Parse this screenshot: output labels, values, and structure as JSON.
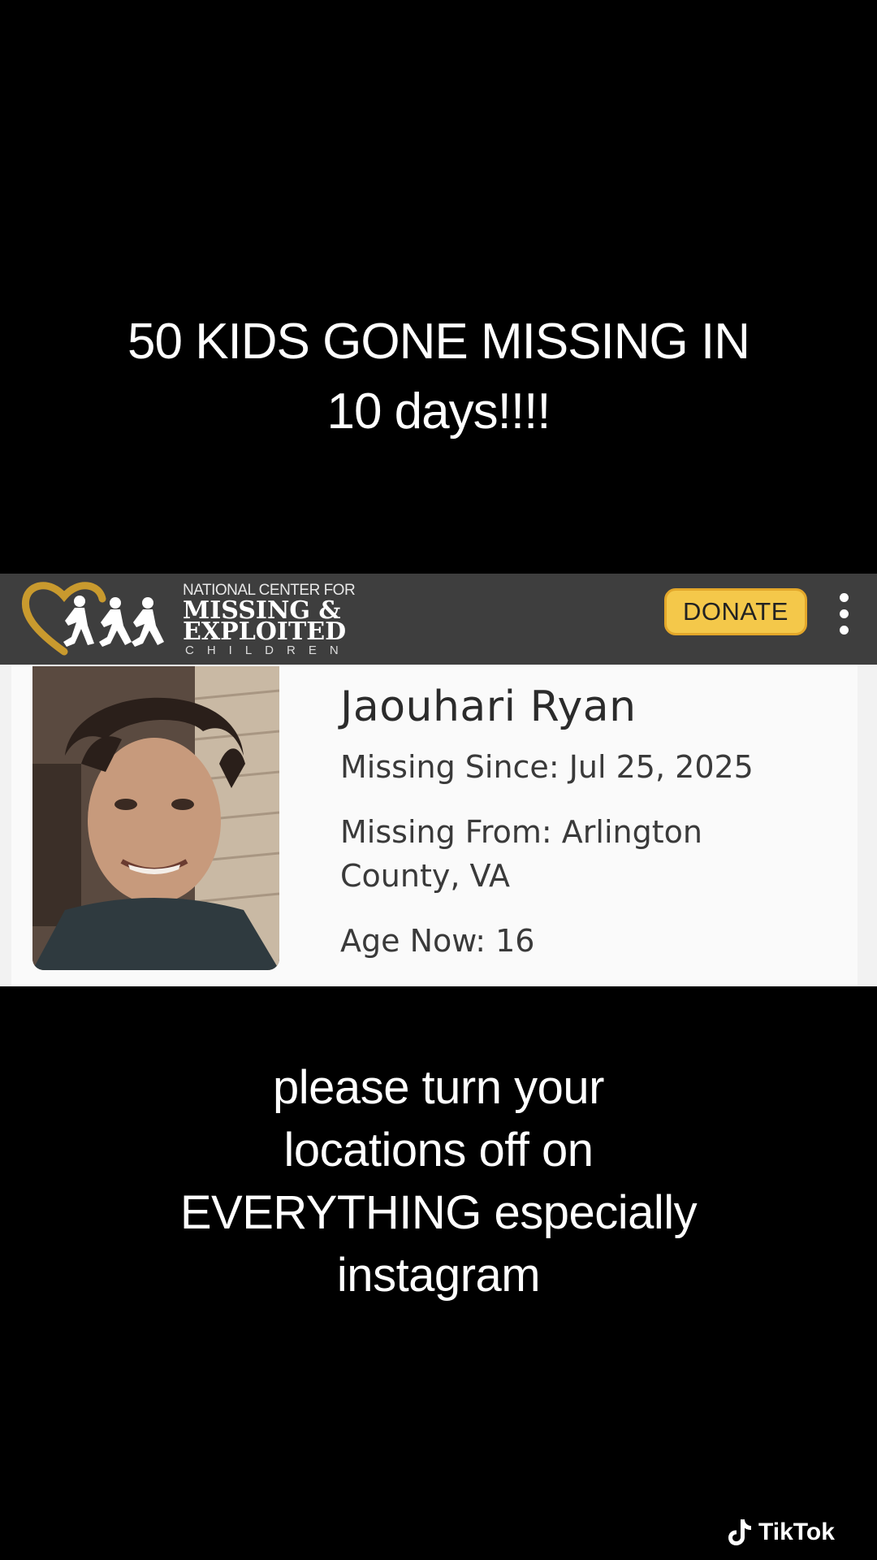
{
  "overlay": {
    "top_line1": "50 KIDS GONE MISSING IN",
    "top_line2": "10 days!!!!",
    "bottom_line1": "please turn your",
    "bottom_line2": "locations off on",
    "bottom_line3": "EVERYTHING especially",
    "bottom_line4": "instagram"
  },
  "header": {
    "org_small": "NATIONAL CENTER FOR",
    "org_line1": "MISSING &",
    "org_line2": "EXPLOITED",
    "org_line3": "CHILDREN",
    "donate_label": "DONATE",
    "menu_icon": "more-vertical-icon",
    "logo_icon": "ncmec-logo-icon"
  },
  "profile": {
    "name": "Jaouhari Ryan",
    "missing_since": "Missing Since: Jul 25, 2025",
    "missing_from_line1": "Missing From: Arlington",
    "missing_from_line2": "County, VA",
    "age_now": "Age Now: 16"
  },
  "watermark": {
    "label": "TikTok",
    "icon": "tiktok-note-icon"
  },
  "colors": {
    "background": "#000000",
    "header_bar": "#3e3e3e",
    "donate": "#f4c84a",
    "logo_gold": "#c99a2e"
  }
}
